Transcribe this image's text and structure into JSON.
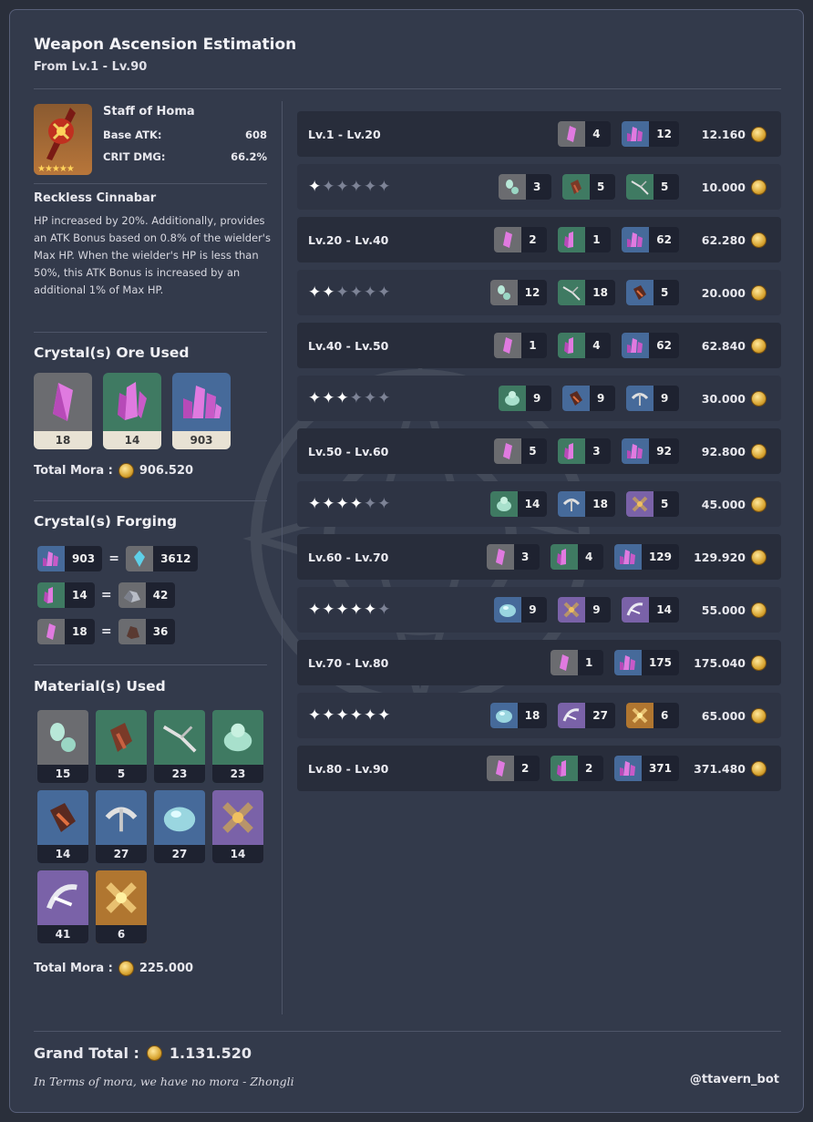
{
  "header": {
    "title": "Weapon Ascension Estimation",
    "subtitle": "From Lv.1 - Lv.90"
  },
  "weapon": {
    "name": "Staff of Homa",
    "stars": "★★★★★",
    "base_atk_label": "Base ATK:",
    "base_atk": "608",
    "crit_label": "CRIT DMG:",
    "crit": "66.2%",
    "passive_title": "Reckless Cinnabar",
    "passive_text": "HP increased by 20%. Additionally, provides an ATK Bonus based on 0.8% of the wielder's Max HP. When the wielder's HP is less than 50%, this ATK Bonus is increased by an additional 1% of Max HP."
  },
  "ore": {
    "title": "Crystal(s) Ore Used",
    "items": [
      "18",
      "14",
      "903"
    ],
    "mora_label": "Total Mora :",
    "mora": "906.520"
  },
  "forging": {
    "title": "Crystal(s) Forging",
    "rows": [
      {
        "a": "903",
        "b": "3612"
      },
      {
        "a": "14",
        "b": "42"
      },
      {
        "a": "18",
        "b": "36"
      }
    ],
    "eq": "="
  },
  "materials": {
    "title": "Material(s) Used",
    "items": [
      "15",
      "5",
      "23",
      "23",
      "14",
      "27",
      "27",
      "14",
      "41",
      "6"
    ],
    "mora_label": "Total Mora :",
    "mora": "225.000"
  },
  "ascension": [
    {
      "label": "Lv.1 - Lv.20",
      "chips": [
        "4",
        "12"
      ],
      "mora": "12.160"
    },
    {
      "stars": 1,
      "chips": [
        "3",
        "5",
        "5"
      ],
      "mora": "10.000"
    },
    {
      "label": "Lv.20 - Lv.40",
      "chips": [
        "2",
        "1",
        "62"
      ],
      "mora": "62.280"
    },
    {
      "stars": 2,
      "chips": [
        "12",
        "18",
        "5"
      ],
      "mora": "20.000"
    },
    {
      "label": "Lv.40 - Lv.50",
      "chips": [
        "1",
        "4",
        "62"
      ],
      "mora": "62.840"
    },
    {
      "stars": 3,
      "chips": [
        "9",
        "9",
        "9"
      ],
      "mora": "30.000"
    },
    {
      "label": "Lv.50 - Lv.60",
      "chips": [
        "5",
        "3",
        "92"
      ],
      "mora": "92.800"
    },
    {
      "stars": 4,
      "chips": [
        "14",
        "18",
        "5"
      ],
      "mora": "45.000"
    },
    {
      "label": "Lv.60 - Lv.70",
      "chips": [
        "3",
        "4",
        "129"
      ],
      "mora": "129.920"
    },
    {
      "stars": 5,
      "chips": [
        "9",
        "9",
        "14"
      ],
      "mora": "55.000"
    },
    {
      "label": "Lv.70 - Lv.80",
      "chips": [
        "1",
        "175"
      ],
      "mora": "175.040"
    },
    {
      "stars": 6,
      "chips": [
        "18",
        "27",
        "6"
      ],
      "mora": "65.000"
    },
    {
      "label": "Lv.80 - Lv.90",
      "chips": [
        "2",
        "2",
        "371"
      ],
      "mora": "371.480"
    }
  ],
  "footer": {
    "grand_label": "Grand Total :",
    "grand": "1.131.520",
    "quote": "In Terms of mora, we have no mora - Zhongli",
    "handle": "@ttavern_bot"
  },
  "colors": {
    "bg": "#333a4b",
    "row": "#282d3b",
    "coin": "#d9a633",
    "crystal": "#d96ad6"
  }
}
